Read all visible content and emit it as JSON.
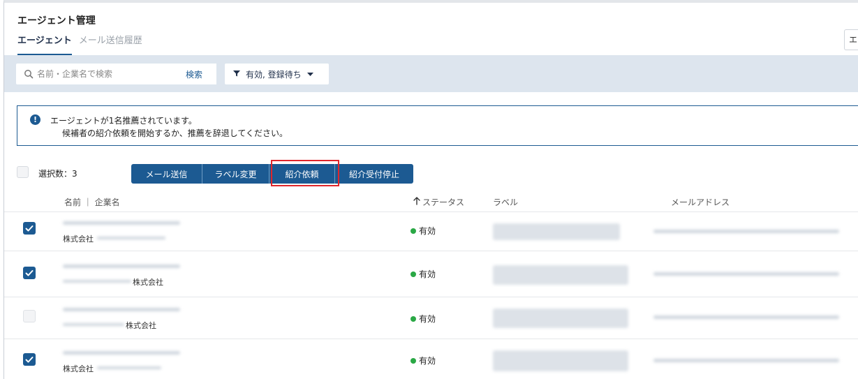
{
  "header": {
    "title": "エージェント管理"
  },
  "tabs": [
    {
      "label": "エージェント",
      "active": true
    },
    {
      "label": "メール送信履歴",
      "active": false
    }
  ],
  "edge_button": {
    "label": "エ"
  },
  "filter": {
    "search_placeholder": "名前・企業名で検索",
    "search_button": "検索",
    "status_filter_label": "有効, 登録待ち"
  },
  "alert": {
    "icon": "!",
    "line1": "エージェントが1名推薦されています。",
    "line2": "候補者の紹介依頼を開始するか、推薦を辞退してください。"
  },
  "selection": {
    "count_label": "選択数：3"
  },
  "actions": [
    {
      "label": "メール送信"
    },
    {
      "label": "ラベル変更"
    },
    {
      "label": "紹介依頼",
      "highlighted": true
    },
    {
      "label": "紹介受付停止"
    }
  ],
  "table": {
    "columns": {
      "name": "名前 ｜ 企業名",
      "status": "ステータス",
      "label": "ラベル",
      "email": "メールアドレス"
    },
    "rows": [
      {
        "checked": true,
        "company_suffix": "株式会社",
        "status": "有効"
      },
      {
        "checked": true,
        "company_suffix": "株式会社",
        "status": "有効"
      },
      {
        "checked": false,
        "company_suffix": "株式会社",
        "status": "有効"
      },
      {
        "checked": true,
        "company_suffix": "株式会社",
        "status": "有効"
      }
    ]
  },
  "colors": {
    "primary": "#1c5a92",
    "filter_bar_bg": "#dde5ee",
    "highlight_border": "#e0262b",
    "status_active": "#2aa845"
  }
}
